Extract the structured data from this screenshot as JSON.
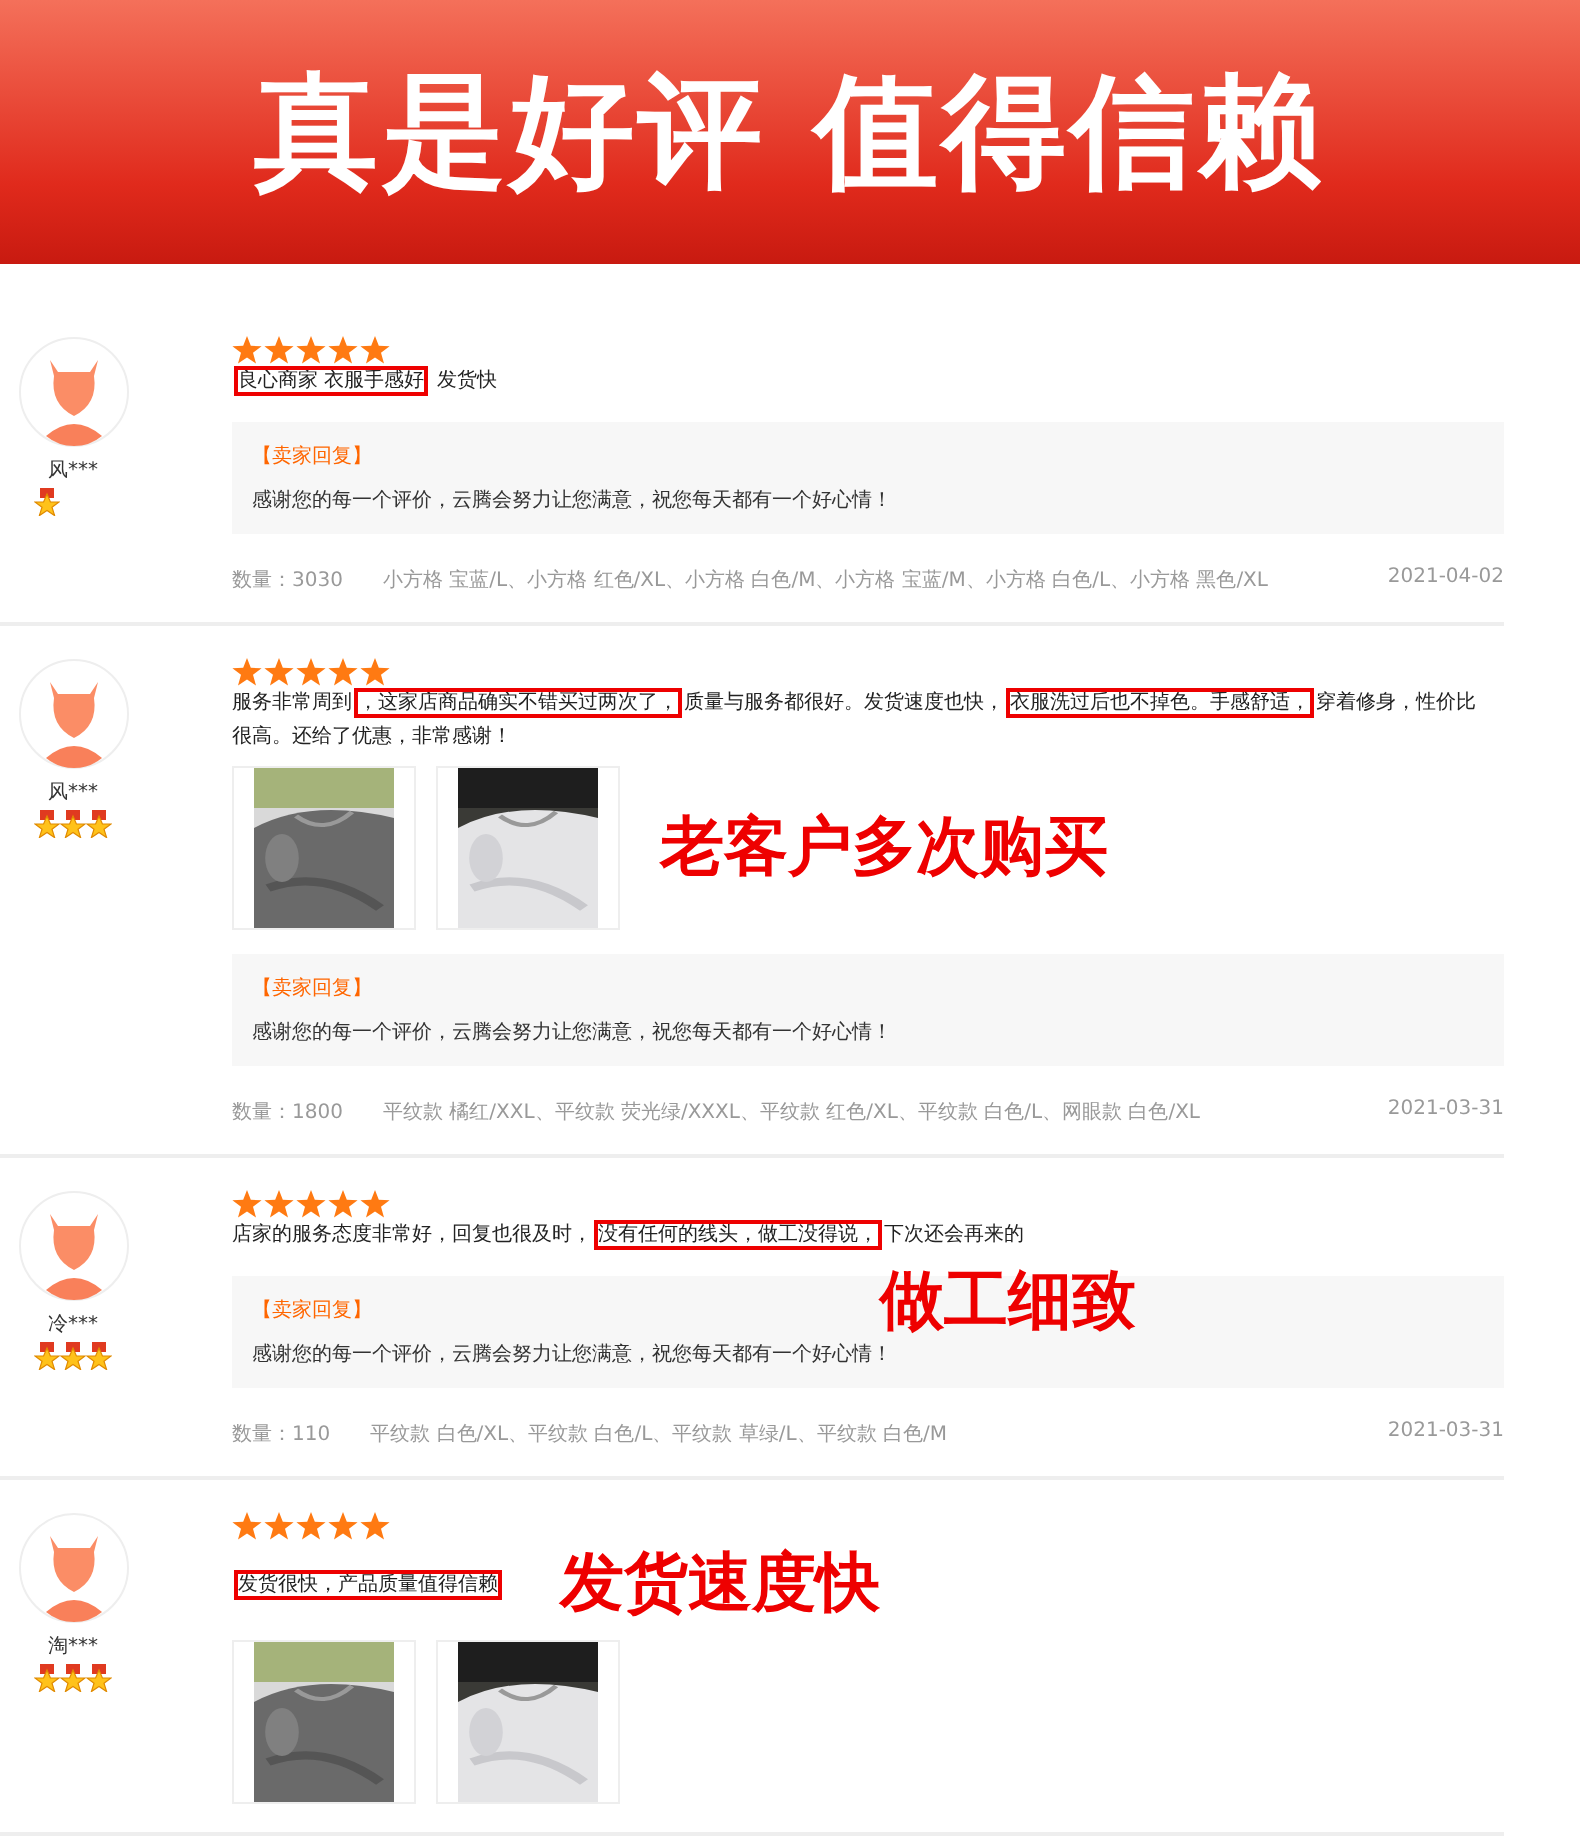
{
  "banner": {
    "title": "真是好评 值得信赖"
  },
  "reviews": [
    {
      "user": "风***",
      "badges": [
        {
          "kind": "medal"
        }
      ],
      "stars": 5,
      "comment": [
        {
          "text": "良心商家 衣服手感好",
          "boxed": true
        },
        {
          "text": " 发货快",
          "boxed": false
        }
      ],
      "reply": {
        "label": "【卖家回复】",
        "text": "感谢您的每一个评价，云腾会努力让您满意，祝您每天都有一个好心情！"
      },
      "quantity": "数量：3030",
      "variants": "小方格 宝蓝/L、小方格 红色/XL、小方格 白色/M、小方格 宝蓝/M、小方格 白色/L、小方格 黑色/XL",
      "date": "2021-04-02"
    },
    {
      "user": "风***",
      "badges": [
        {
          "kind": "medal"
        },
        {
          "kind": "medal"
        },
        {
          "kind": "medal"
        }
      ],
      "stars": 5,
      "comment": [
        {
          "text": "服务非常周到",
          "boxed": false
        },
        {
          "text": "，这家店商品确实不错买过两次了，",
          "boxed": true
        },
        {
          "text": "质量与服务都很好。发货速度也快，",
          "boxed": false
        },
        {
          "text": "衣服洗过后也不掉色。手感舒适，",
          "boxed": true
        },
        {
          "text": "穿着修身，性价比很高。还给了优惠，非常感谢！",
          "boxed": false
        }
      ],
      "photos": [
        {
          "kind": "picture"
        },
        {
          "kind": "picture"
        }
      ],
      "photo_callout": "老客户多次购买",
      "reply": {
        "label": "【卖家回复】",
        "text": "感谢您的每一个评价，云腾会努力让您满意，祝您每天都有一个好心情！"
      },
      "quantity": "数量：1800",
      "variants": "平纹款 橘红/XXL、平纹款 荧光绿/XXXL、平纹款 红色/XL、平纹款 白色/L、网眼款 白色/XL",
      "date": "2021-03-31"
    },
    {
      "user": "冷***",
      "badges": [
        {
          "kind": "medal"
        },
        {
          "kind": "medal"
        },
        {
          "kind": "medal"
        }
      ],
      "stars": 5,
      "comment": [
        {
          "text": "店家的服务态度非常好，回复也很及时，",
          "boxed": false
        },
        {
          "text": "没有任何的线头，做工没得说，",
          "boxed": true
        },
        {
          "text": "下次还会再来的",
          "boxed": false
        }
      ],
      "reply_callout": "做工细致",
      "reply": {
        "label": "【卖家回复】",
        "text": "感谢您的每一个评价，云腾会努力让您满意，祝您每天都有一个好心情！"
      },
      "quantity": "数量：110",
      "variants": "平纹款 白色/XL、平纹款 白色/L、平纹款 草绿/L、平纹款 白色/M",
      "date": "2021-03-31"
    },
    {
      "user": "淘***",
      "badges": [
        {
          "kind": "medal"
        },
        {
          "kind": "medal"
        },
        {
          "kind": "medal"
        }
      ],
      "stars": 5,
      "comment": [
        {
          "text": "发货很快，产品质量值得信赖",
          "boxed": true
        }
      ],
      "photos": [
        {
          "kind": "picture"
        },
        {
          "kind": "picture"
        }
      ],
      "comment_callout": "发货速度快"
    }
  ]
}
